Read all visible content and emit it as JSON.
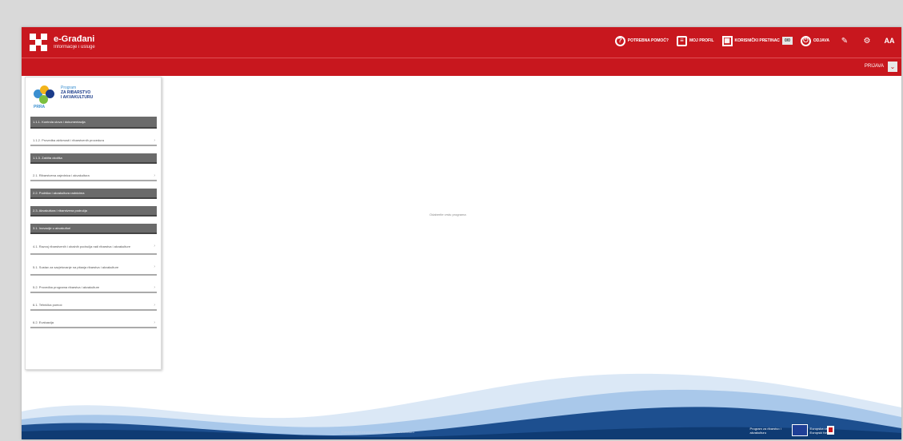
{
  "header": {
    "site_name": "e-Građani",
    "site_subtitle": "Informacije i usluge",
    "tools": [
      {
        "icon": "help-icon",
        "label": "POTREBNA POMOĆ?"
      },
      {
        "icon": "document-icon",
        "label": "MOJ PROFIL"
      },
      {
        "icon": "calendar-icon",
        "label": "KORISNIČKI PRETINAC",
        "badge": "0/0"
      },
      {
        "icon": "power-icon",
        "label": "ODJAVA"
      }
    ],
    "icon_buttons": [
      "edit-icon",
      "settings-icon"
    ],
    "text_size_label": "AA"
  },
  "subbar": {
    "login_label": "PRIJAVA",
    "chevron": "⌄"
  },
  "sidebar": {
    "program_logo": {
      "line1": "Program",
      "line2": "ZA RIBARSTVO",
      "line3": "I AKVAKULTURU",
      "abbr": "PRRA"
    },
    "items": [
      {
        "label": "1.1.1. Kontrola ulova i dokumentacija",
        "active": true
      },
      {
        "label": "1.1.2. Provedba aktivnosti i ribarstvenih procedura",
        "active": false
      },
      {
        "label": "1.1.3. Zaštita okoliša",
        "active": true
      },
      {
        "label": "2.1. Ribarstvena zajednica i akvakultura",
        "active": false
      },
      {
        "label": "2.2. Podrška i akvakultura radnicima",
        "active": true
      },
      {
        "label": "2.3. Akvakultura i ribarstvena područja",
        "active": true
      },
      {
        "label": "3.1. Inovacije u akvakulturi",
        "active": true
      },
      {
        "label": "4.1. Razvoj ribarstvenih i obalnih područja radi ribarstva i akvakulture",
        "active": false
      },
      {
        "label": "5.1. Sustav za savjetovanje na pitanja ribarstva i akvakulture",
        "active": false
      },
      {
        "label": "5.2. Provedba programa ribarstva i akvakulture",
        "active": false
      },
      {
        "label": "6.1. Tehnička pomoć",
        "active": false
      },
      {
        "label": "6.2. Evaluacija",
        "active": false
      }
    ]
  },
  "main": {
    "message": "Odaberite vrstu programa"
  },
  "footer": {
    "text": "Europski fond za pomorstvo, ribarstvo i akvakulturu",
    "eu_label": "Europska unija",
    "eu_sub": "Europski fond",
    "program_label": "Program za ribarstvo i akvakulturu"
  },
  "colors": {
    "brand_red": "#c8171e",
    "footer_blue": "#0f3b73",
    "active_item": "#6b6b6b"
  }
}
